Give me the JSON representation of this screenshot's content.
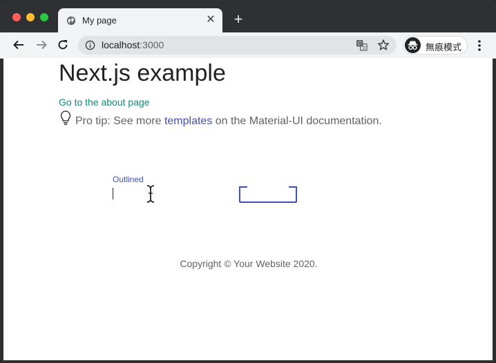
{
  "browser": {
    "tab": {
      "title": "My page",
      "close_glyph": "✕",
      "icon": "globe-icon"
    },
    "new_tab_glyph": "+",
    "address_bar": {
      "host": "localhost",
      "port": ":3000"
    },
    "profile": {
      "label": "無痕模式",
      "icon": "incognito-icon"
    },
    "icons": [
      "back-arrow-icon",
      "forward-arrow-icon",
      "reload-icon",
      "info-icon",
      "translate-icon",
      "star-icon",
      "more-vert-icon"
    ],
    "colors": {
      "close": "#fe5f57",
      "minimize": "#febc2e",
      "maximize": "#28c840"
    }
  },
  "page": {
    "heading": "Next.js example",
    "about_link": "Go to the about page",
    "protip": {
      "before": "Pro tip: See more ",
      "link": "templates",
      "after": " on the Material-UI documentation."
    },
    "text_field": {
      "label": "Outlined",
      "value": ""
    },
    "copyright": "Copyright © Your Website 2020.",
    "colors": {
      "primary": "#3f51b5",
      "secondary": "#19857b"
    }
  }
}
